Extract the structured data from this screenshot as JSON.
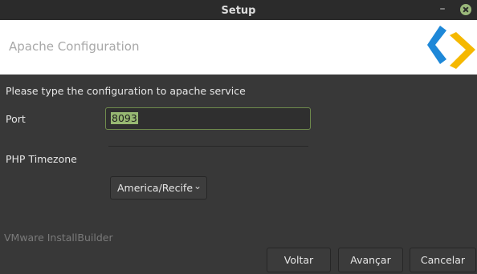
{
  "window": {
    "title": "Setup"
  },
  "header": {
    "title": "Apache Configuration"
  },
  "form": {
    "prompt": "Please type the configuration to apache service",
    "port_label": "Port",
    "port_value": "8093",
    "timezone_label": "PHP Timezone",
    "timezone_value": "America/Recife"
  },
  "footer": {
    "brand": "VMware InstallBuilder",
    "back_label": "Voltar",
    "next_label": "Avançar",
    "cancel_label": "Cancelar"
  },
  "icons": {
    "minimize": "minimize-icon",
    "close": "close-icon",
    "dropdown": "chevron-down-icon",
    "logo": "installbuilder-logo"
  },
  "colors": {
    "accent_green": "#97b872",
    "logo_blue": "#1e88d8",
    "logo_yellow": "#f5b800"
  }
}
